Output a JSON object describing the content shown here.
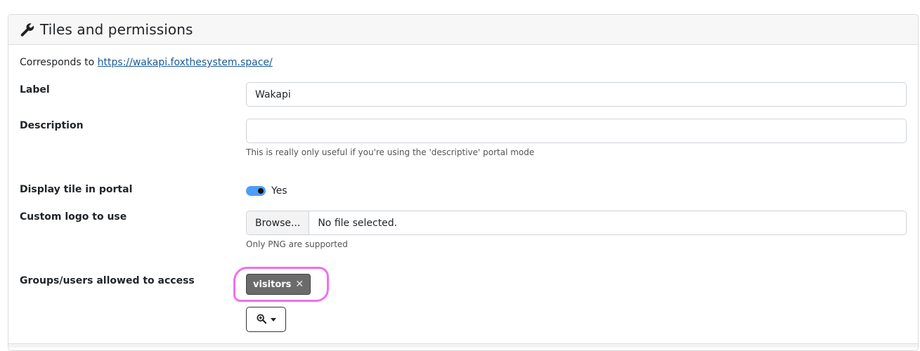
{
  "header": {
    "title": "Tiles and permissions",
    "icon": "wrench-icon"
  },
  "corresponds": {
    "prefix": "Corresponds to ",
    "url": "https://wakapi.foxthesystem.space/"
  },
  "form": {
    "label": {
      "label": "Label",
      "value": "Wakapi"
    },
    "description": {
      "label": "Description",
      "value": "",
      "help": "This is really only useful if you're using the 'descriptive' portal mode"
    },
    "display_tile": {
      "label": "Display tile in portal",
      "state": "Yes",
      "enabled": true,
      "accent": "#4f9cf5"
    },
    "custom_logo": {
      "label": "Custom logo to use",
      "browse_label": "Browse...",
      "file_status": "No file selected.",
      "help": "Only PNG are supported"
    },
    "access": {
      "label": "Groups/users allowed to access",
      "chips": [
        {
          "label": "visitors",
          "remove": "✕"
        }
      ],
      "search_icon": "zoom-in-icon",
      "highlight_color": "#f06ef0"
    }
  }
}
